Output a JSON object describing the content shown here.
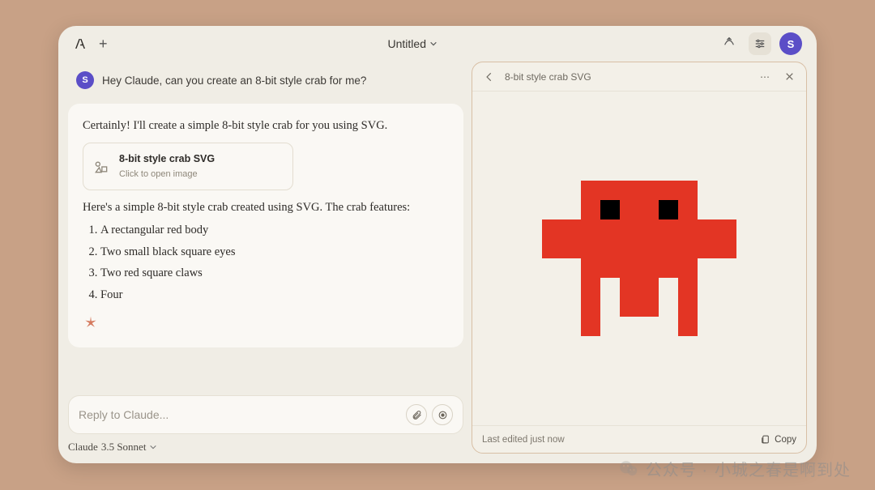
{
  "header": {
    "title": "Untitled",
    "avatar_initial": "S"
  },
  "user_message": {
    "avatar_initial": "S",
    "text": "Hey Claude, can you create an 8-bit style crab for me?"
  },
  "assistant": {
    "intro": "Certainly! I'll create a simple 8-bit style crab for you using SVG.",
    "asset": {
      "title": "8-bit style crab SVG",
      "subtitle": "Click to open image"
    },
    "followup": "Here's a simple 8-bit style crab created using SVG. The crab features:",
    "features": [
      "A rectangular red body",
      "Two small black square eyes",
      "Two red square claws",
      "Four"
    ]
  },
  "composer": {
    "placeholder": "Reply to Claude...",
    "model_family": "Claude",
    "model_name": "3.5 Sonnet"
  },
  "artifact": {
    "title": "8-bit style crab SVG",
    "footer_status": "Last edited just now",
    "copy_label": "Copy",
    "crab_color": "#e33524",
    "eye_color": "#000000"
  },
  "watermark": {
    "prefix": "公众号 ·",
    "text": "小城之春是啊到处"
  }
}
